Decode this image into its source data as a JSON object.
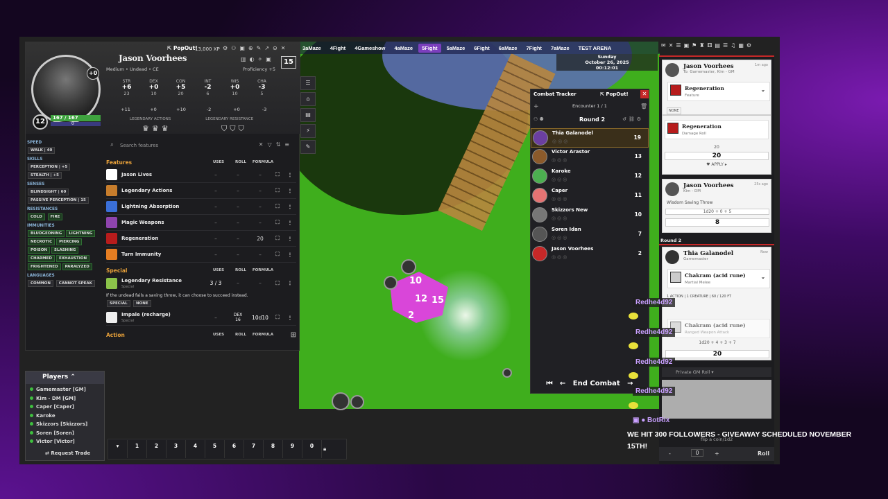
{
  "map_tabs": [
    "3aMaze",
    "4Fight",
    "4Gameshow",
    "4aMaze",
    "5Fight",
    "5aMaze",
    "6Fight",
    "6aMaze",
    "7Fight",
    "7aMaze",
    "TEST ARENA"
  ],
  "active_tab": "5Fight",
  "calendar": {
    "day": "Sunday",
    "date": "October 26, 2025",
    "time": "00:12:01"
  },
  "character": {
    "popout": "PopOut!",
    "xp": "13,000 XP",
    "name": "Jason Voorhees",
    "race": "Medium • Undead • CE",
    "proficiency": "Proficiency +5",
    "ac": "15",
    "level": "12",
    "init": "+0",
    "hp": "167 / 167",
    "hp_temp": "0",
    "stats": [
      {
        "ab": "STR",
        "mod": "+6",
        "score": "23"
      },
      {
        "ab": "DEX",
        "mod": "+0",
        "score": "10"
      },
      {
        "ab": "CON",
        "mod": "+5",
        "score": "20"
      },
      {
        "ab": "INT",
        "mod": "-2",
        "score": "6"
      },
      {
        "ab": "WIS",
        "mod": "+0",
        "score": "10"
      },
      {
        "ab": "CHA",
        "mod": "-3",
        "score": "5"
      }
    ],
    "saves": [
      "+11",
      "+0",
      "+10",
      "-2",
      "+0",
      "-3"
    ],
    "legendary_actions_label": "LEGENDARY ACTIONS",
    "legendary_resistance_label": "LEGENDARY RESISTANCE",
    "sidebar": {
      "speed_h": "SPEED",
      "walk": "WALK | 40",
      "skills_h": "SKILLS",
      "perception": "PERCEPTION | +5",
      "stealth": "STEALTH | +5",
      "senses_h": "SENSES",
      "blindsight": "BLINDSIGHT | 60",
      "passive": "PASSIVE PERCEPTION | 15",
      "resistances_h": "RESISTANCES",
      "cold": "COLD",
      "fire": "FIRE",
      "immunities_h": "IMMUNITIES",
      "immunities": [
        "BLUDGEONING",
        "LIGHTNING",
        "NECROTIC",
        "PIERCING",
        "POISON",
        "SLASHING",
        "CHARMED",
        "EXHAUSTION",
        "FRIGHTENED",
        "PARALYZED"
      ],
      "languages_h": "LANGUAGES",
      "common": "COMMON",
      "cannot_speak": "CANNOT SPEAK"
    },
    "search_placeholder": "Search features",
    "features_header": {
      "title": "Features",
      "uses": "USES",
      "roll": "ROLL",
      "formula": "FORMULA"
    },
    "features": [
      {
        "name": "Jason Lives",
        "uses": "–",
        "roll": "–",
        "formula": "–",
        "color": "#ffffff"
      },
      {
        "name": "Legendary Actions",
        "uses": "–",
        "roll": "–",
        "formula": "–",
        "color": "#c77d2c"
      },
      {
        "name": "Lightning Absorption",
        "uses": "–",
        "roll": "–",
        "formula": "–",
        "color": "#3a6fd8"
      },
      {
        "name": "Magic Weapons",
        "uses": "–",
        "roll": "–",
        "formula": "–",
        "color": "#8e44ad"
      },
      {
        "name": "Regeneration",
        "uses": "–",
        "roll": "–",
        "formula": "20",
        "color": "#b71c1c"
      },
      {
        "name": "Turn Immunity",
        "uses": "–",
        "roll": "–",
        "formula": "–",
        "color": "#e67e22"
      }
    ],
    "special_header": {
      "title": "Special",
      "uses": "USES",
      "roll": "ROLL",
      "formula": "FORMULA"
    },
    "special": {
      "name": "Legendary Resistance",
      "tag": "Special",
      "uses": "3 / 3",
      "roll": "–",
      "formula": "–",
      "text": "If the undead fails a saving throw, it can choose to succeed instead.",
      "tags": [
        "SPECIAL",
        "NONE"
      ]
    },
    "impale": {
      "name": "Impale (recharge)",
      "tag": "Special",
      "uses": "–",
      "roll_label": "DEX",
      "roll": "16",
      "formula": "10d10"
    },
    "action_header": {
      "title": "Action",
      "uses": "USES",
      "roll": "ROLL",
      "formula": "FORMULA"
    }
  },
  "players": {
    "title": "Players",
    "list": [
      "Gamemaster [GM]",
      "Kim - DM [GM]",
      "Caper [Caper]",
      "Karoke",
      "Skizzors [Skizzors]",
      "Soren [Soren]",
      "Victor [Victor]"
    ],
    "trade": "Request Trade"
  },
  "hotbar": [
    "1",
    "2",
    "3",
    "4",
    "5",
    "6",
    "7",
    "8",
    "9",
    "0"
  ],
  "tracker": {
    "title": "Combat Tracker",
    "popout": "PopOut!",
    "encounter": "Encounter 1 / 1",
    "round": "Round 2",
    "combatants": [
      {
        "name": "Thia Galanodel",
        "init": "19",
        "active": true
      },
      {
        "name": "Victor Arastor",
        "init": "13",
        "active": false
      },
      {
        "name": "Karoke",
        "init": "12",
        "active": false
      },
      {
        "name": "Caper",
        "init": "11",
        "active": false
      },
      {
        "name": "Skizzors New",
        "init": "10",
        "active": false
      },
      {
        "name": "Soren Idan",
        "init": "7",
        "active": false
      },
      {
        "name": "Jason Voorhees",
        "init": "2",
        "active": false
      }
    ],
    "end": "End Combat"
  },
  "chatlog": {
    "card1": {
      "who": "Jason Voorhees",
      "sub": "To: Gamemaster, Kim - GM",
      "time": "1m ago",
      "feature": "Regeneration",
      "feature_sub": "Feature",
      "none": "NONE"
    },
    "card1b": {
      "feature": "Regeneration",
      "feature_sub": "Damage Roll",
      "formula": "20",
      "total": "20",
      "apply": "APPLY"
    },
    "card2": {
      "who": "Jason Voorhees",
      "sub": "Kim - DM",
      "time": "25s ago",
      "label": "Wisdom Saving Throw",
      "formula": "1d20 + 0 + 5",
      "total": "8"
    },
    "round_label": "Round 2",
    "card3": {
      "who": "Thia Galanodel",
      "sub": "Gamemaster",
      "time": "Now",
      "feature": "Chakram (acid rune)",
      "feature_sub": "Martial Melee",
      "tags": [
        "1 ACTION",
        "1 CREATURE",
        "60 / 120 FT"
      ],
      "attack": "Chakram (acid rune)",
      "attack_sub": "Ranged Weapon Attack",
      "formula": "1d20 + 4 + 3 + 7",
      "total": "20"
    },
    "rollmode": "Private GM Roll",
    "coin": "flip a coin/1d2",
    "bottom": {
      "minus": "-",
      "val": "0",
      "plus": "+",
      "roll": "Roll"
    }
  },
  "stream": {
    "messages": [
      "Redhe4d92",
      "Redhe4d92",
      "Redhe4d92",
      "Redhe4d92"
    ],
    "bot": "BotRix",
    "banner": "WE HIT 300 FOLLOWERS - GIVEAWAY SCHEDULED NOVEMBER 15TH!"
  },
  "die": {
    "faces": [
      "10",
      "12",
      "15",
      "2"
    ]
  }
}
